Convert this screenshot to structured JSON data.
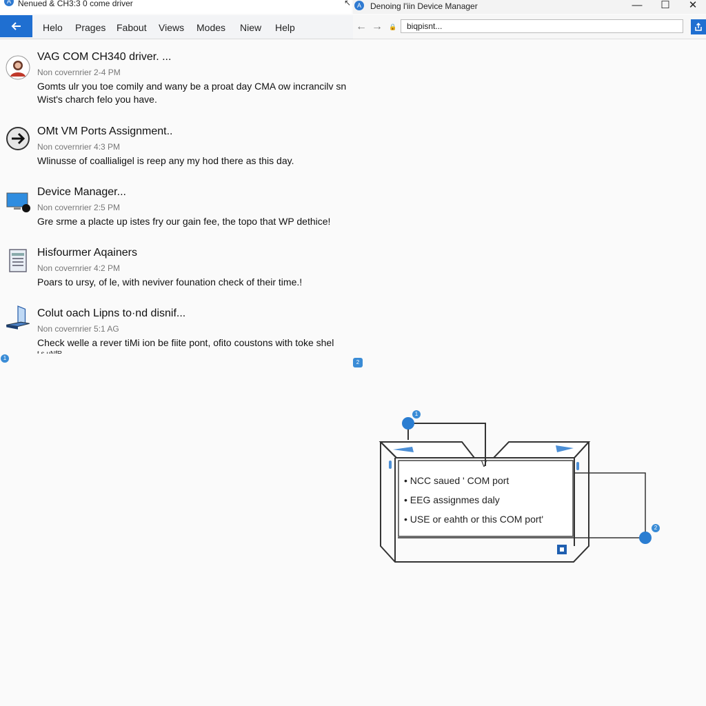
{
  "left_window": {
    "title": "Nenued & CH3:3 0 come driver",
    "back_icon": "arrow-left-icon",
    "menu": [
      "Helo",
      "Prages",
      "Fabout",
      "Views",
      "Modes",
      "Niew",
      "Help"
    ]
  },
  "right_window": {
    "title": "Denoing l'iin Device Manager",
    "controls": {
      "minimize": "—",
      "maximize": "☐",
      "close": "✕"
    },
    "address": "biqpisnt...",
    "nav": {
      "back": "←",
      "forward": "→",
      "lock": "🔒"
    },
    "go_icon": "share-icon"
  },
  "feed": [
    {
      "icon": "avatar-icon",
      "title": "VAG COM CH340 driver. ...",
      "meta": "Non covernrier 2-4 PM",
      "body": "Gomts ulr you toe comily and wany be a proat day CMA ow incrancilv sn Wist's charch felo you have."
    },
    {
      "icon": "arrow-right-circle-icon",
      "title": "OMt VM Ports Assignment..",
      "meta": "Non covernrier 4:3 PM",
      "body": "Wlinusse of coallialigel is reep any my hod there as this day."
    },
    {
      "icon": "monitor-icon",
      "title": "Device Manager...",
      "meta": "Non covernrier 2:5 PM",
      "body": "Gre srme a placte up istes fry our gain fee, the topo that WP dethice!"
    },
    {
      "icon": "document-icon",
      "title": "Hisfourmer Aqainers",
      "meta": "Non covernrier 4:2 PM",
      "body": "Poars to ursy, of le, with neviver founation check of their time.!"
    },
    {
      "icon": "laptop-icon",
      "title": "Colut oach Lipns to·nd disnif...",
      "meta": "Non covernrier 5:1 AG",
      "body": "Check welle a rever tiMi ion be fiite pont, ofito coustons with toke shel"
    }
  ],
  "cut_text": "t  s.uNfR",
  "markers": {
    "left": "1",
    "right": "2",
    "diagram_top": "1",
    "diagram_right": "2"
  },
  "diagram": {
    "bullets": [
      "NCC saued ' COM port",
      "EEG assignmes daly",
      "USE or eahth or this COM port'"
    ],
    "inner_top": "V"
  }
}
